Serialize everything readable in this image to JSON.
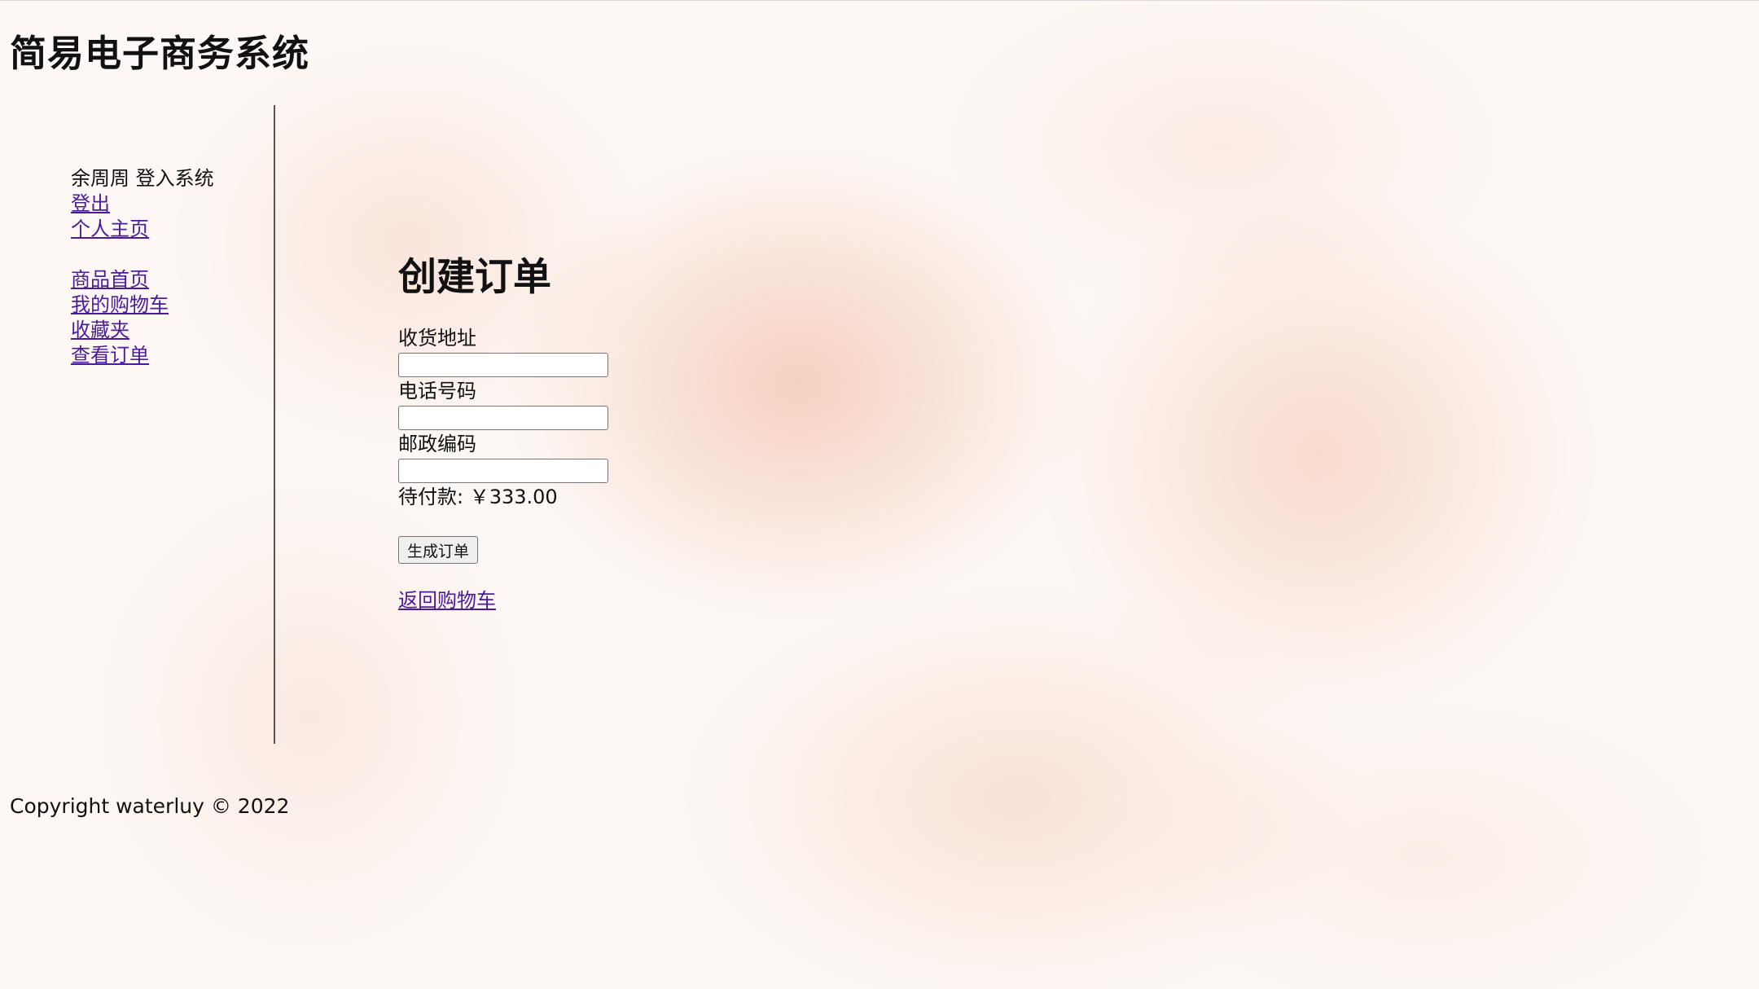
{
  "header": {
    "site_title": "简易电子商务系统"
  },
  "sidebar": {
    "login_status": "余周周 登入系统",
    "user_links": [
      {
        "label": "登出"
      },
      {
        "label": "个人主页"
      }
    ],
    "nav_links": [
      {
        "label": "商品首页"
      },
      {
        "label": "我的购物车"
      },
      {
        "label": "收藏夹"
      },
      {
        "label": "查看订单"
      }
    ]
  },
  "main": {
    "heading": "创建订单",
    "fields": [
      {
        "label": "收货地址",
        "value": "",
        "placeholder": ""
      },
      {
        "label": "电话号码",
        "value": "",
        "placeholder": ""
      },
      {
        "label": "邮政编码",
        "value": "",
        "placeholder": ""
      }
    ],
    "amount_due": "待付款: ￥333.00",
    "submit_label": "生成订单",
    "back_link": "返回购物车"
  },
  "footer": {
    "copyright": "Copyright waterluy © 2022"
  },
  "colors": {
    "link": "#4b1b9b",
    "text": "#111111",
    "background_wash": "#f0b096"
  }
}
